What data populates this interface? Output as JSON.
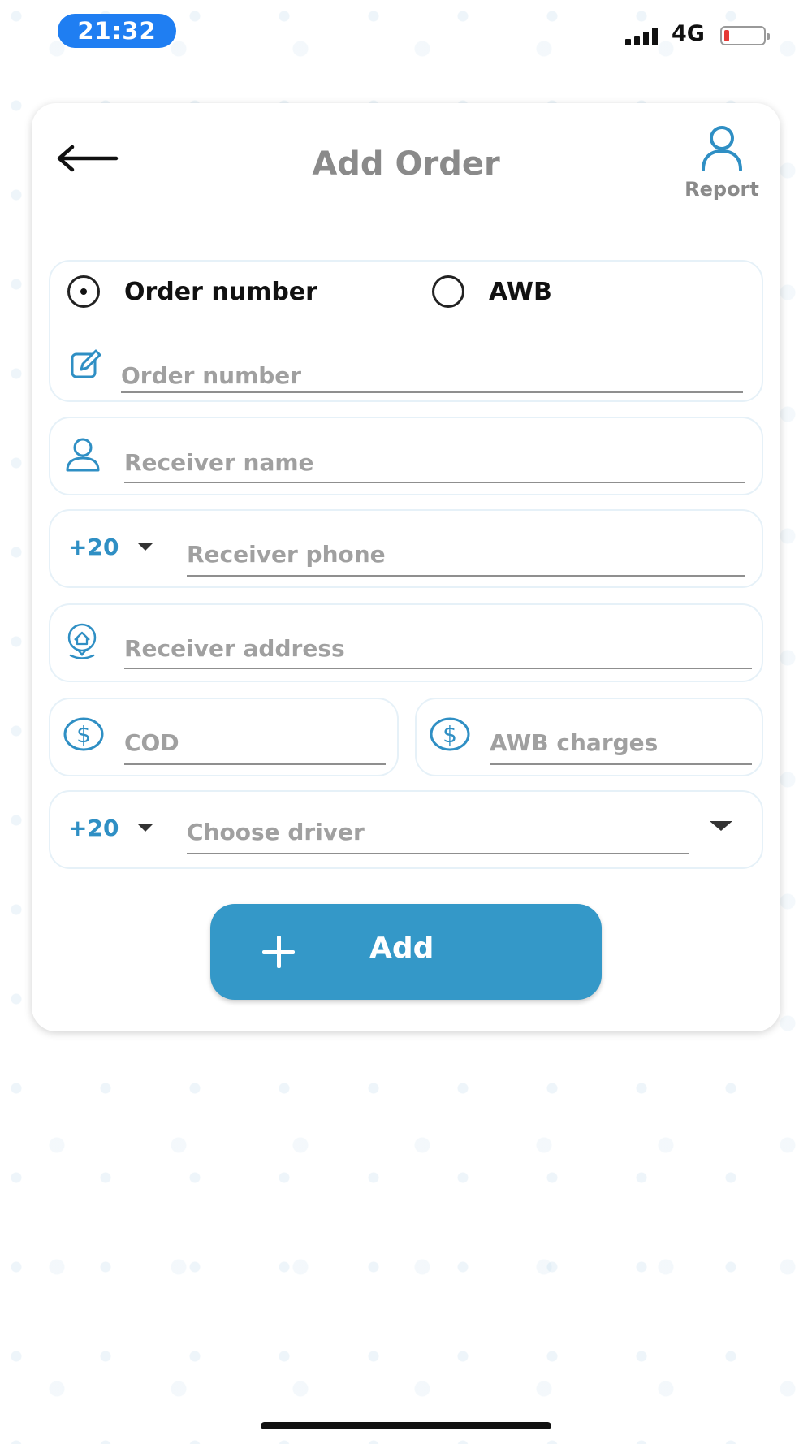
{
  "status_bar": {
    "time": "21:32",
    "network": "4G",
    "battery_level": 0.12
  },
  "header": {
    "title": "Add Order",
    "report_label": "Report"
  },
  "lookup": {
    "options": [
      "Order number",
      "AWB"
    ],
    "selected": "Order number",
    "order_number_placeholder": "Order number"
  },
  "receiver": {
    "name_placeholder": "Receiver name",
    "phone_country_code": "+20",
    "phone_placeholder": "Receiver phone",
    "address_placeholder": "Receiver address"
  },
  "charges": {
    "cod_placeholder": "COD",
    "awb_charges_placeholder": "AWB charges"
  },
  "driver": {
    "country_code": "+20",
    "placeholder": "Choose driver"
  },
  "submit": {
    "label": "Add"
  },
  "colors": {
    "accent": "#3498c8",
    "title_gray": "#8a8a8a",
    "time_pill": "#1f7ef2"
  },
  "icons": [
    "back-arrow-icon",
    "person-icon",
    "edit-icon",
    "user-icon",
    "location-pin-icon",
    "dollar-icon",
    "plus-icon",
    "chevron-down-icon"
  ]
}
